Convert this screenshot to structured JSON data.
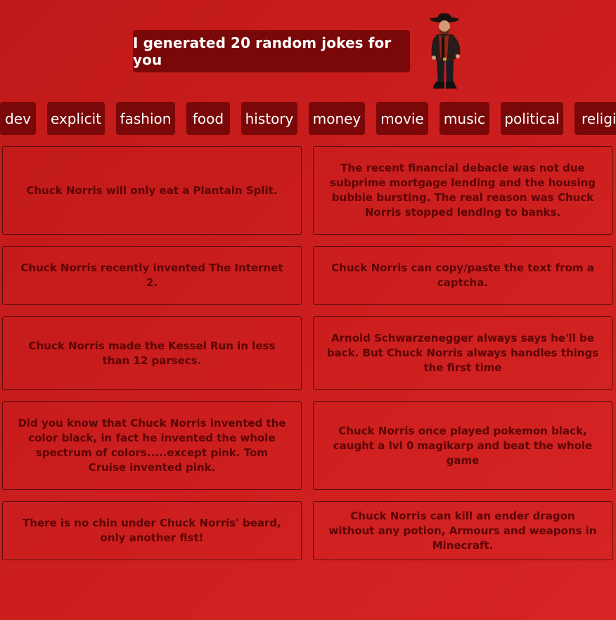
{
  "header": {
    "title": "I generated 20 random jokes for you",
    "mascot_icon": "cowboy-chuck-norris-icon"
  },
  "categories": [
    "dev",
    "explicit",
    "fashion",
    "food",
    "history",
    "money",
    "movie",
    "music",
    "political",
    "religion"
  ],
  "jokes": [
    "Chuck Norris will only eat a Plantain Split.",
    "The recent financial debacle was not due subprime mortgage lending and the housing bubble bursting. The real reason was Chuck Norris stopped lending to banks.",
    "Chuck Norris recently invented The Internet 2.",
    "Chuck Norris can copy/paste the text from a captcha.",
    "Chuck Norris made the Kessel Run in less than 12 parsecs.",
    "Arnold Schwarzenegger always says he'll be back. But Chuck Norris always handles things the first time",
    "Did you know that Chuck Norris invented the color black, in fact he invented the whole spectrum of colors.....except pink. Tom Cruise invented pink.",
    "Chuck Norris once played pokemon black, caught a lvl 0 magikarp and beat the whole game",
    "There is no chin under Chuck Norris' beard, only another fist!",
    "Chuck Norris can kill an ender dragon without any potion, Armours and weapons in Minecraft."
  ],
  "colors": {
    "background": "#cc1e1e",
    "button": "#7a0808",
    "joke_text": "#5c0505"
  }
}
